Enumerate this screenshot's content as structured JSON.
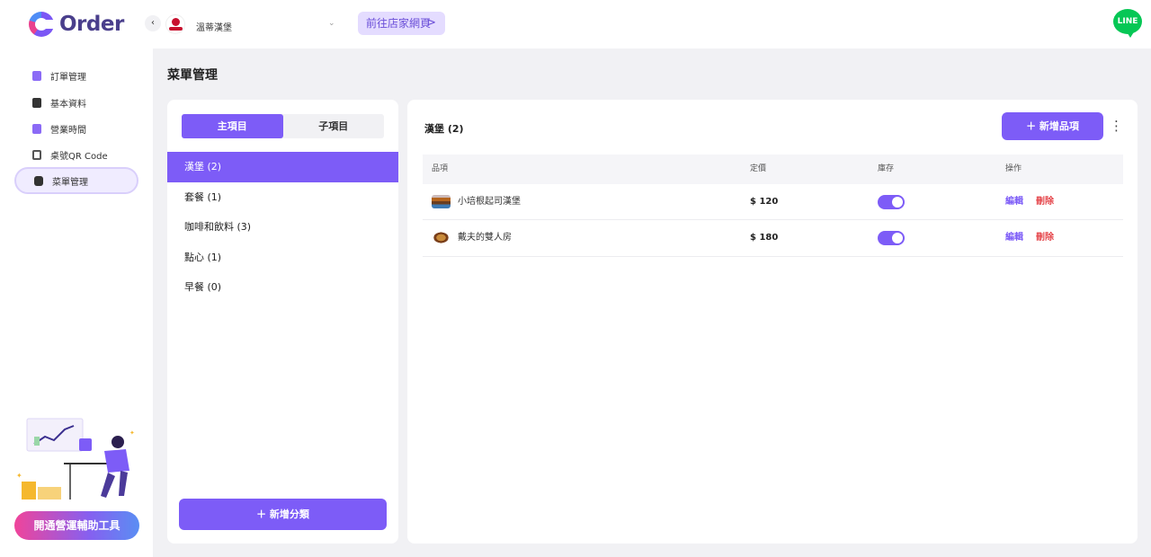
{
  "brand": {
    "name": "Order"
  },
  "header": {
    "collapse_glyph": "‹",
    "store_name": "溫蒂漢堡",
    "store_chevron": "⌄",
    "visit_store_label": "前往店家網頁",
    "visit_arrow": ">",
    "line_label": "LINE"
  },
  "sidebar": {
    "items": [
      {
        "label": "訂單管理",
        "icon": "clipboard-icon"
      },
      {
        "label": "基本資料",
        "icon": "document-icon"
      },
      {
        "label": "營業時間",
        "icon": "calendar-icon"
      },
      {
        "label": "桌號QR Code",
        "icon": "qr-code-icon"
      },
      {
        "label": "菜單管理",
        "icon": "menu-book-icon",
        "active": true
      }
    ],
    "promo_label": "開通營運輔助工具"
  },
  "page": {
    "title": "菜單管理"
  },
  "categories": {
    "tabs": [
      {
        "label": "主項目",
        "active": true
      },
      {
        "label": "子項目",
        "active": false
      }
    ],
    "items": [
      {
        "label": "漢堡 (2)",
        "active": true
      },
      {
        "label": "套餐 (1)"
      },
      {
        "label": "咖啡和飲料 (3)"
      },
      {
        "label": "點心 (1)"
      },
      {
        "label": "早餐 (0)"
      }
    ],
    "add_label": "新增分類",
    "add_glyph": "＋"
  },
  "items_panel": {
    "title": "漢堡 (2)",
    "add_label": "新增品項",
    "add_glyph": "＋",
    "more_glyph": "⋮",
    "columns": [
      "品項",
      "定價",
      "庫存",
      "操作"
    ],
    "rows": [
      {
        "name": "小培根起司漢堡",
        "price": "$ 120",
        "in_stock": true,
        "edit": "編輯",
        "delete": "刪除"
      },
      {
        "name": "戴夫的雙人房",
        "price": "$ 180",
        "in_stock": true,
        "edit": "編輯",
        "delete": "刪除"
      }
    ]
  },
  "colors": {
    "accent": "#7d5cf7",
    "accent_light": "#e4dcff",
    "danger": "#e5484d",
    "line_green": "#06c755",
    "background": "#f1f1f4"
  }
}
